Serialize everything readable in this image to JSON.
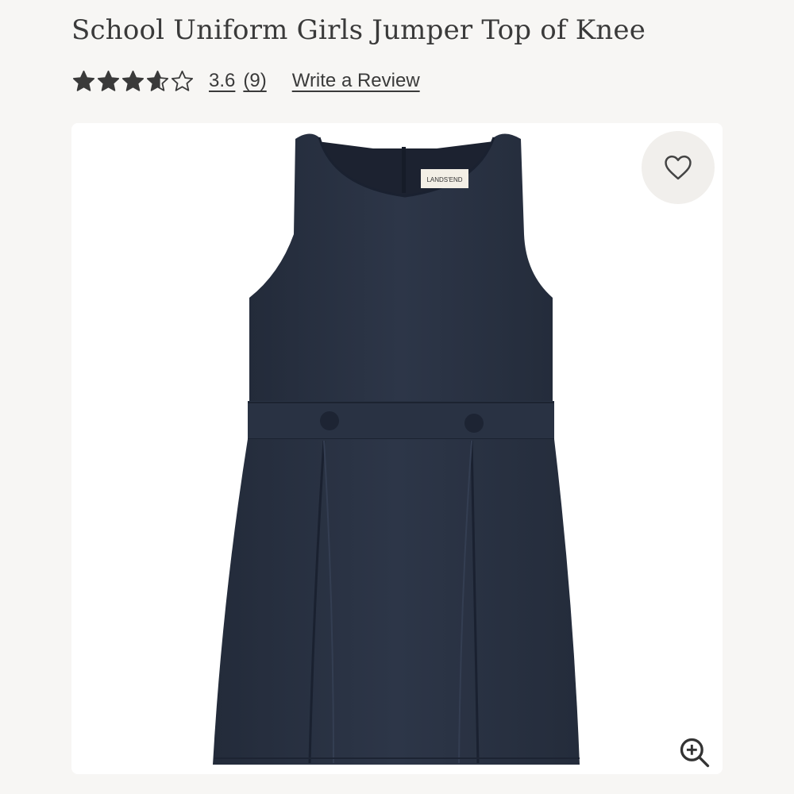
{
  "product": {
    "title": "School Uniform Girls Jumper Top of Knee",
    "rating_value": "3.6",
    "rating_count": "(9)",
    "rating_stars": 3.6,
    "write_review_label": "Write a Review",
    "image_label_text": "LANDS'END",
    "product_color": "#2b3445"
  },
  "icons": {
    "favorite": "heart-icon",
    "zoom": "zoom-in-icon",
    "rating": "star-icon"
  },
  "colors": {
    "text": "#3a3a3a",
    "star": "#3a3a3a",
    "background": "#f7f6f4",
    "card": "#ffffff",
    "favorite_bg": "#f1efec"
  }
}
